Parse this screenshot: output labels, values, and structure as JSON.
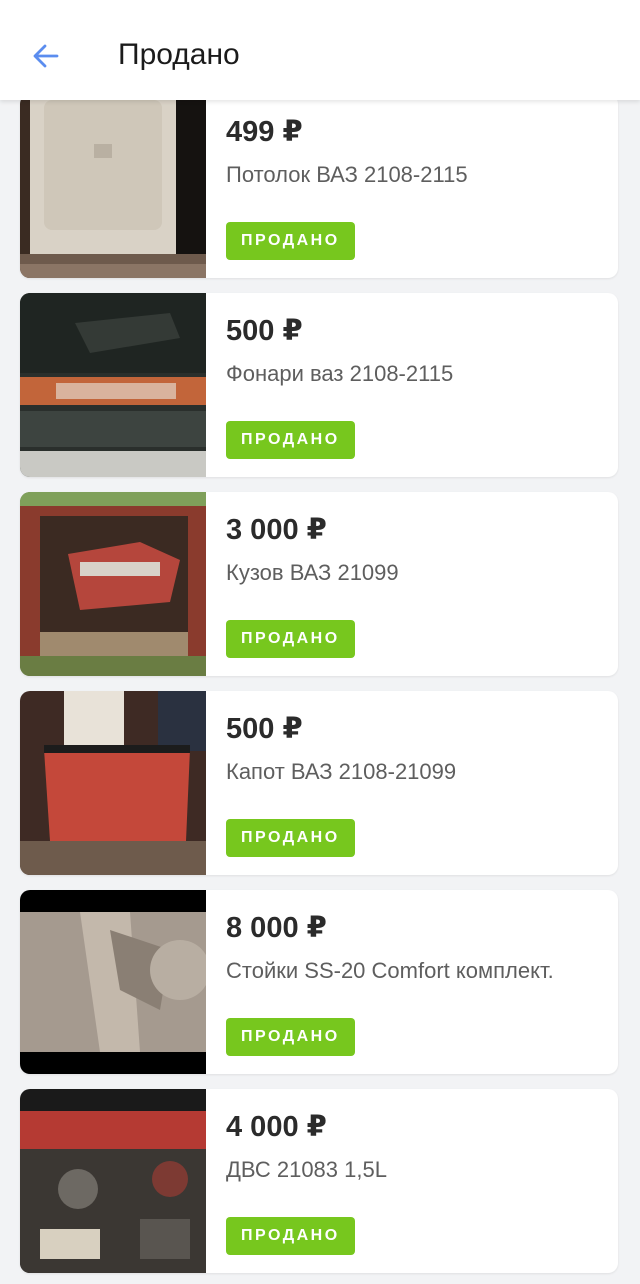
{
  "header": {
    "title": "Продано",
    "back_icon": "arrow-left-icon",
    "accent_color": "#5b8def"
  },
  "badge_color": "#77c71e",
  "items": [
    {
      "price": "499 ₽",
      "title": "Потолок ВАЗ 2108-2115",
      "status": "ПРОДАНО"
    },
    {
      "price": "500 ₽",
      "title": "Фонари ваз 2108-2115",
      "status": "ПРОДАНО"
    },
    {
      "price": "3 000 ₽",
      "title": "Кузов ВАЗ 21099",
      "status": "ПРОДАНО"
    },
    {
      "price": "500 ₽",
      "title": "Капот ВАЗ 2108-21099",
      "status": "ПРОДАНО"
    },
    {
      "price": "8 000 ₽",
      "title": "Стойки SS-20 Comfort комплект.",
      "status": "ПРОДАНО"
    },
    {
      "price": "4 000 ₽",
      "title": "ДВС 21083 1,5L",
      "status": "ПРОДАНО"
    }
  ]
}
